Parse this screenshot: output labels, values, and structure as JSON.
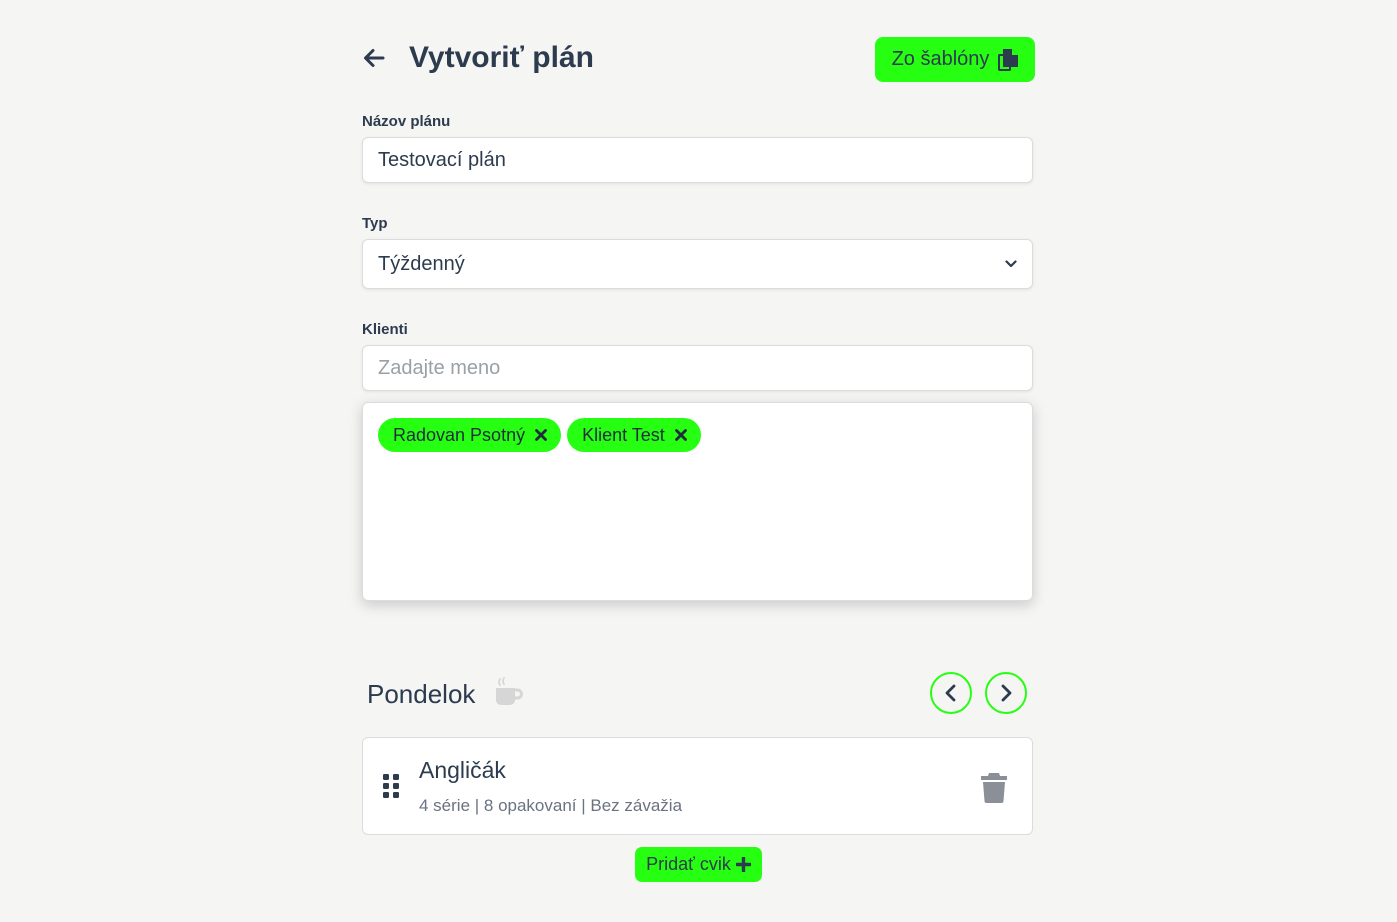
{
  "header": {
    "title": "Vytvoriť plán",
    "template_button_label": "Zo šablóny",
    "back_icon": "arrow-left-icon",
    "template_icon": "copy-icon"
  },
  "form": {
    "name_label": "Názov plánu",
    "name_value": "Testovací plán",
    "type_label": "Typ",
    "type_value": "Týždenný",
    "clients_label": "Klienti",
    "clients_placeholder": "Zadajte meno",
    "selected_clients": [
      "Radovan Psotný",
      "Klient Test"
    ]
  },
  "day": {
    "name": "Pondelok",
    "rest_icon": "coffee-icon",
    "prev_icon": "chevron-left-icon",
    "next_icon": "chevron-right-icon"
  },
  "exercises": [
    {
      "name": "Angličák",
      "details": "4 série | 8 opakovaní | Bez závažia"
    }
  ],
  "add_exercise_label": "Pridať cvik",
  "colors": {
    "accent": "#26ff12",
    "text": "#2d3b4e",
    "background": "#f5f5f4",
    "muted": "#6b7280"
  }
}
